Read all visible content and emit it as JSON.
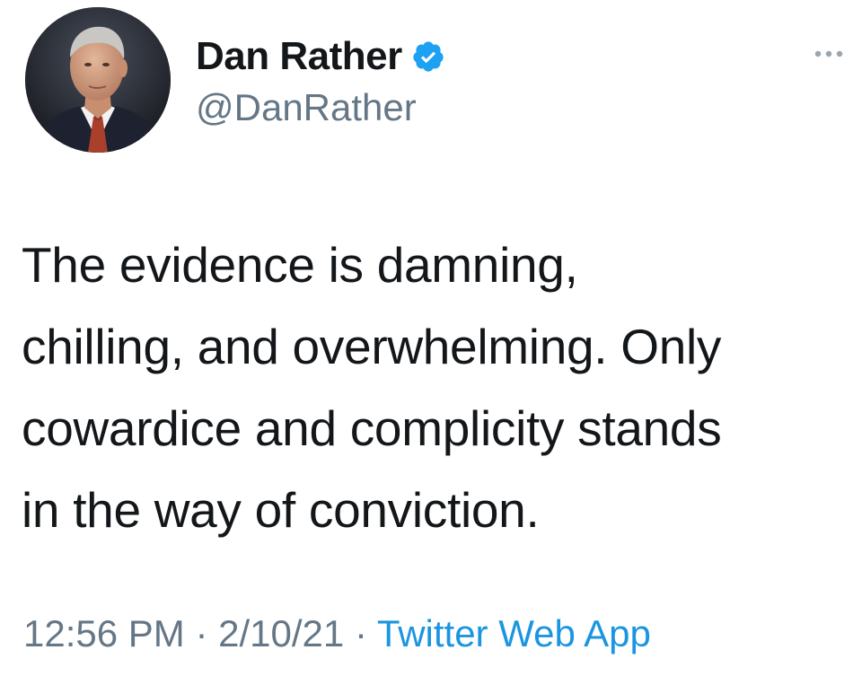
{
  "author": {
    "display_name": "Dan Rather",
    "handle": "@DanRather",
    "verified_icon": "verified-badge-icon",
    "avatar": "profile-photo"
  },
  "tweet": {
    "lines": [
      "The evidence is damning,",
      "chilling, and overwhelming. Only",
      "cowardice and complicity stands",
      "in the way of conviction."
    ]
  },
  "meta": {
    "time": "12:56 PM",
    "separator": "·",
    "date": "2/10/21",
    "source": "Twitter Web App"
  },
  "colors": {
    "text": "#14171a",
    "secondary": "#657786",
    "accent": "#1b95e0",
    "verified": "#1da1f2"
  },
  "icons": {
    "more": "more-options-icon"
  }
}
